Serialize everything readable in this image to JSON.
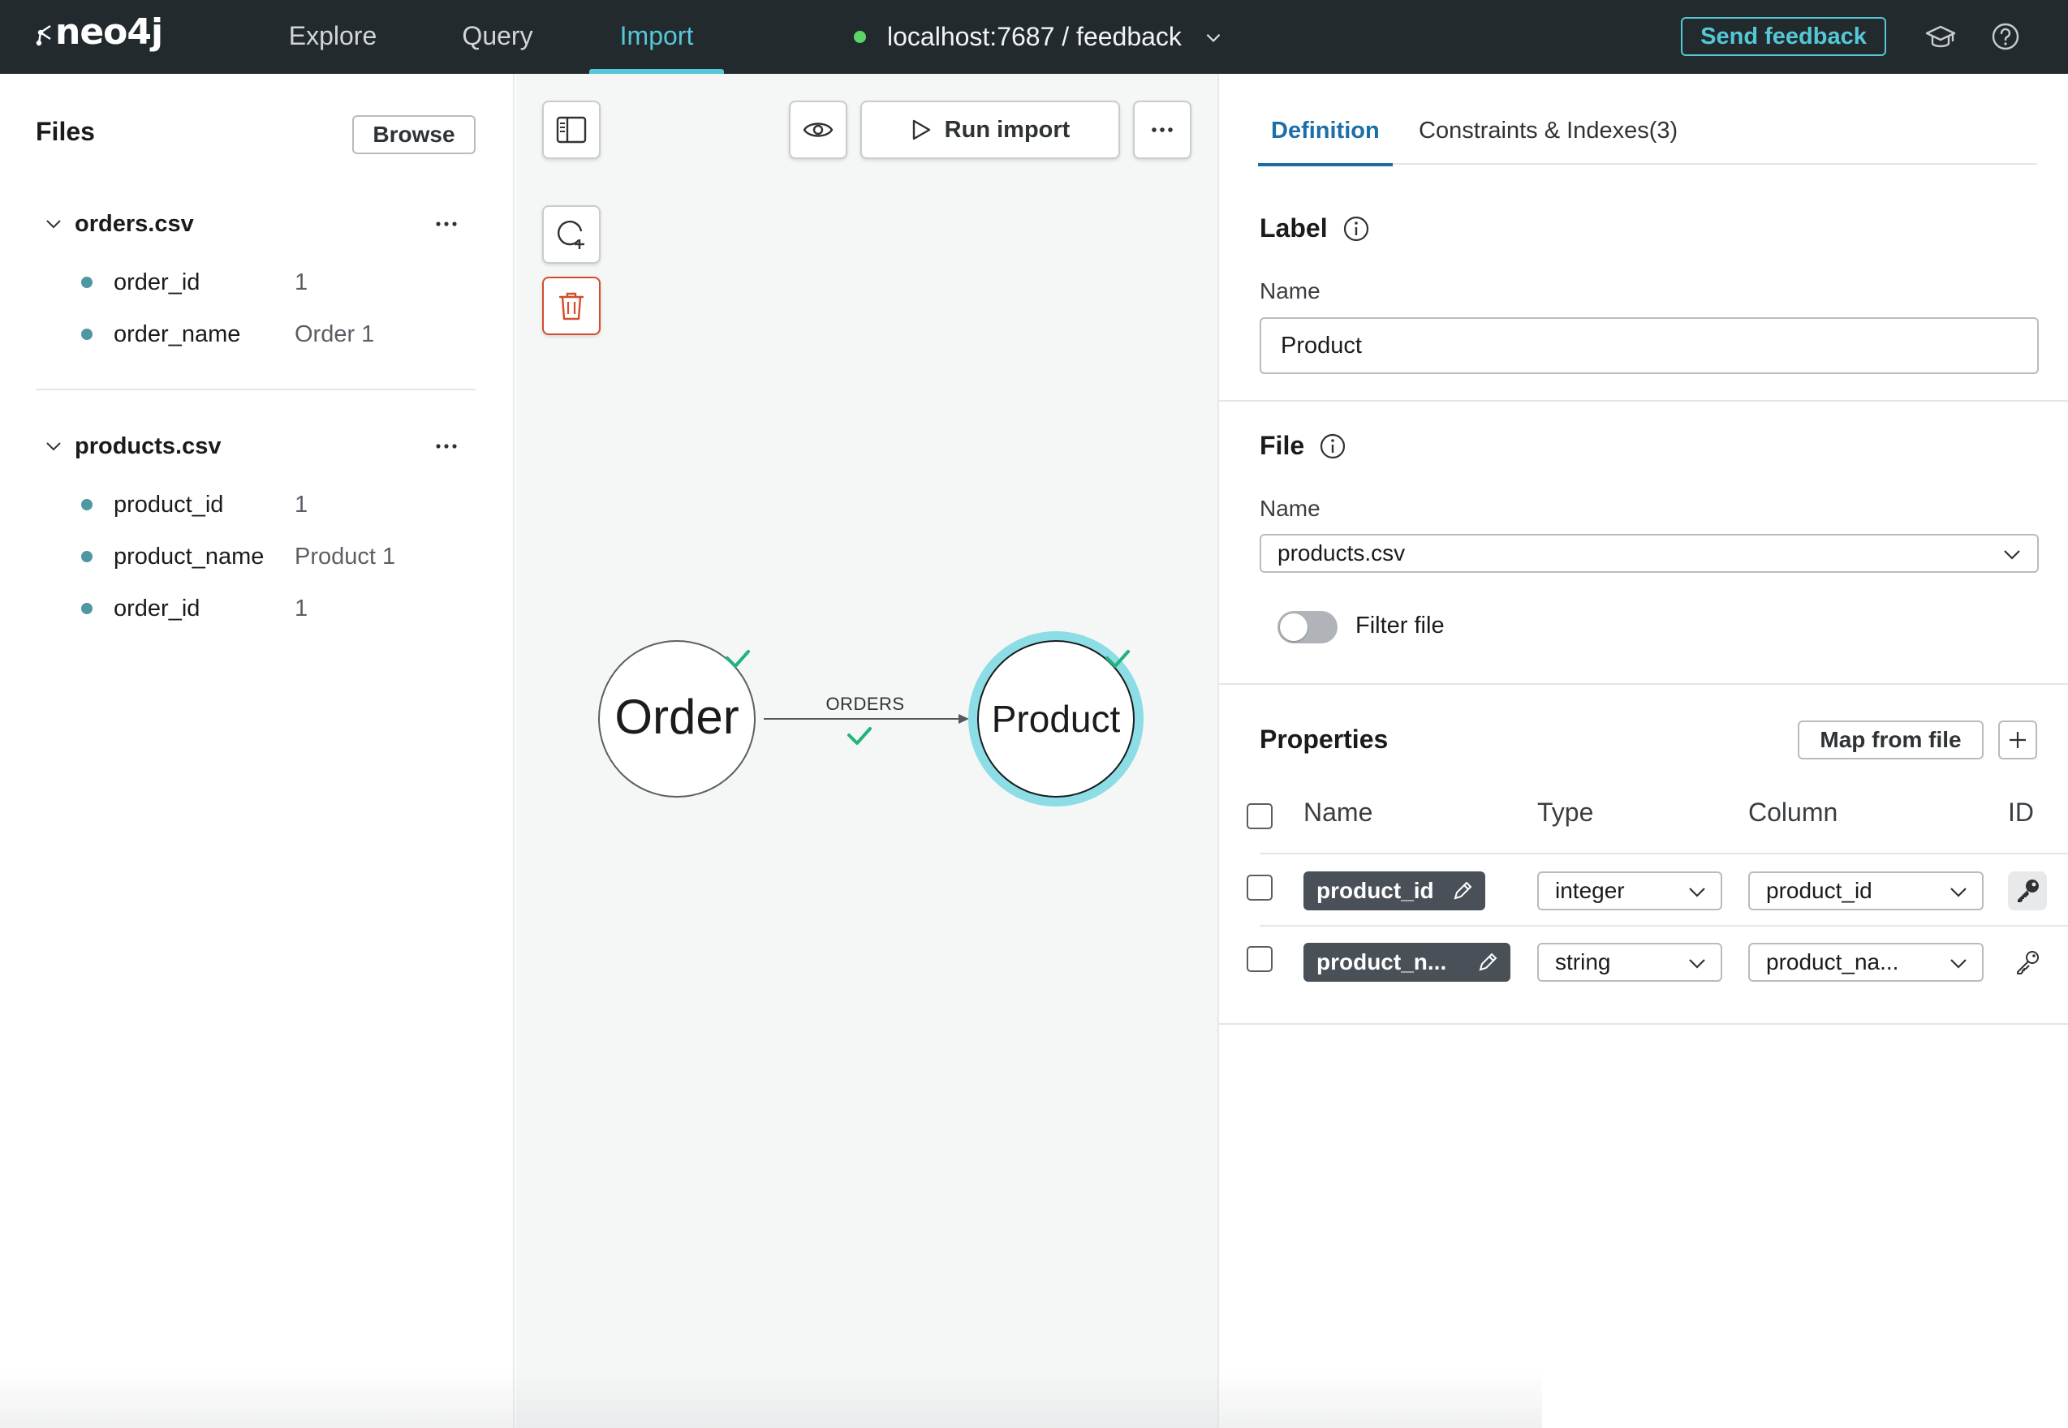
{
  "app": {
    "logo_text": "neo4j",
    "nav": [
      "Explore",
      "Query",
      "Import"
    ],
    "active_nav": "Import",
    "connection": "localhost:7687 / feedback",
    "send_feedback": "Send feedback",
    "accent_color": "#55c8d6"
  },
  "files": {
    "title": "Files",
    "browse_label": "Browse",
    "groups": [
      {
        "name": "orders.csv",
        "fields": [
          {
            "name": "order_id",
            "value": "1"
          },
          {
            "name": "order_name",
            "value": "Order 1"
          }
        ]
      },
      {
        "name": "products.csv",
        "fields": [
          {
            "name": "product_id",
            "value": "1"
          },
          {
            "name": "product_name",
            "value": "Product 1"
          },
          {
            "name": "order_id",
            "value": "1"
          }
        ]
      }
    ]
  },
  "canvas": {
    "run_import_label": "Run import",
    "nodes": [
      {
        "label": "Order",
        "selected": false,
        "mapped": true
      },
      {
        "label": "Product",
        "selected": true,
        "mapped": true
      }
    ],
    "relationships": [
      {
        "type": "ORDERS",
        "from": "Order",
        "to": "Product",
        "mapped": true
      }
    ]
  },
  "definition": {
    "tabs": [
      "Definition",
      "Constraints & Indexes(3)"
    ],
    "active_tab": "Definition",
    "label_section": {
      "title": "Label",
      "name_label": "Name",
      "name_value": "Product"
    },
    "file_section": {
      "title": "File",
      "name_label": "Name",
      "selected_file": "products.csv",
      "filter_label": "Filter file",
      "filter_on": false
    },
    "properties_section": {
      "title": "Properties",
      "map_from_file": "Map from file",
      "columns": [
        "Name",
        "Type",
        "Column",
        "ID"
      ],
      "rows": [
        {
          "name": "product_id",
          "type": "integer",
          "column": "product_id",
          "is_id": true
        },
        {
          "name": "product_n...",
          "type": "string",
          "column": "product_na...",
          "is_id": false
        }
      ]
    }
  }
}
